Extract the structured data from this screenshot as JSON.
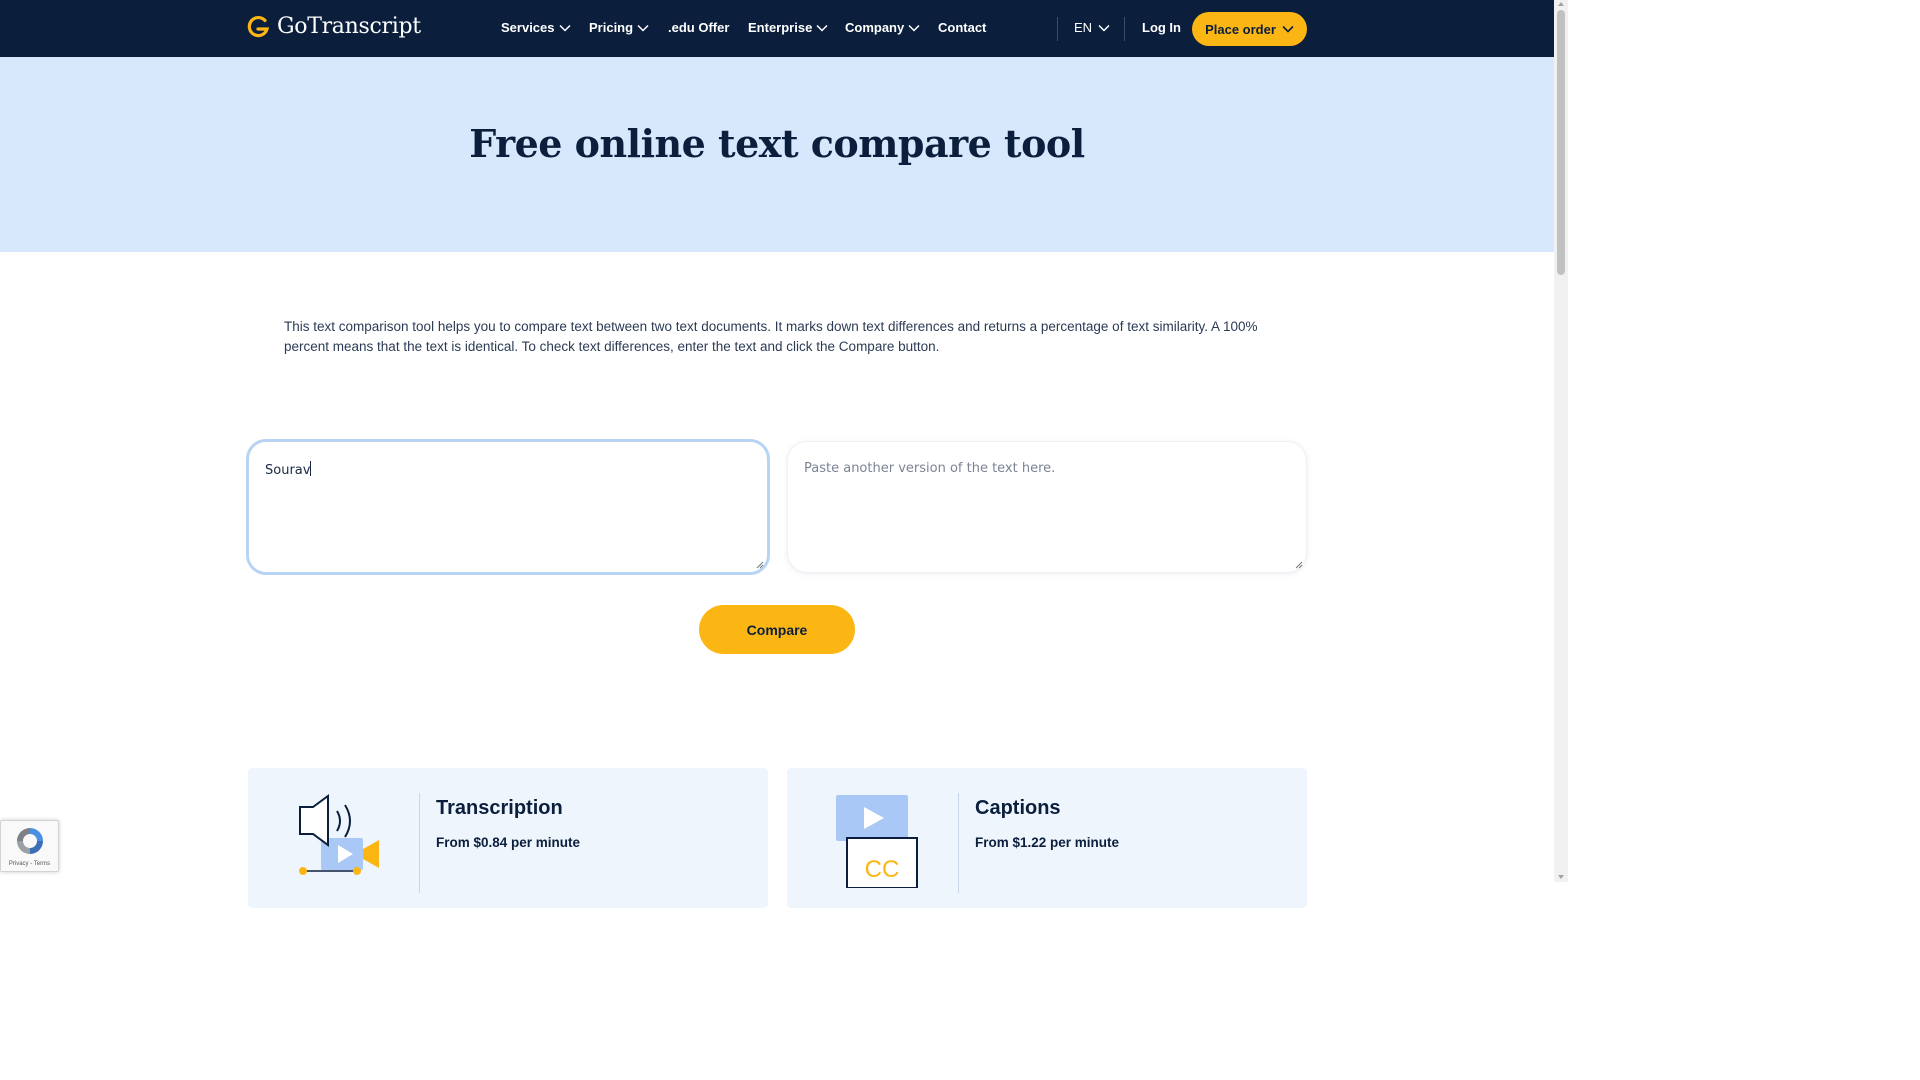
{
  "brand": {
    "name": "GoTranscript",
    "accent": "#fbb614",
    "navy": "#0b1f3d"
  },
  "nav": {
    "items": [
      {
        "label": "Services",
        "dropdown": true
      },
      {
        "label": "Pricing",
        "dropdown": true
      },
      {
        "label": ".edu Offer",
        "dropdown": false
      },
      {
        "label": "Enterprise",
        "dropdown": true
      },
      {
        "label": "Company",
        "dropdown": true
      },
      {
        "label": "Contact",
        "dropdown": false
      }
    ],
    "language": "EN",
    "login": "Log In",
    "place_order": "Place order"
  },
  "hero": {
    "title": "Free online text compare tool"
  },
  "intro": {
    "text": "This text comparison tool helps you to compare text between two text documents. It marks down text differences and returns a percentage of text similarity. A 100% percent means that the text is identical. To check text differences, enter the text and click the Compare button."
  },
  "compare_tool": {
    "left_value": "Sourav",
    "right_placeholder": "Paste another version of the text here.",
    "button_label": "Compare"
  },
  "services": [
    {
      "title": "Transcription",
      "price": "From $0.84 per minute",
      "icon": "speaker-video-icon"
    },
    {
      "title": "Captions",
      "price": "From $1.22 per minute",
      "icon": "cc-video-icon",
      "icon_text": "CC"
    }
  ],
  "recaptcha": {
    "links": "Privacy - Terms"
  }
}
